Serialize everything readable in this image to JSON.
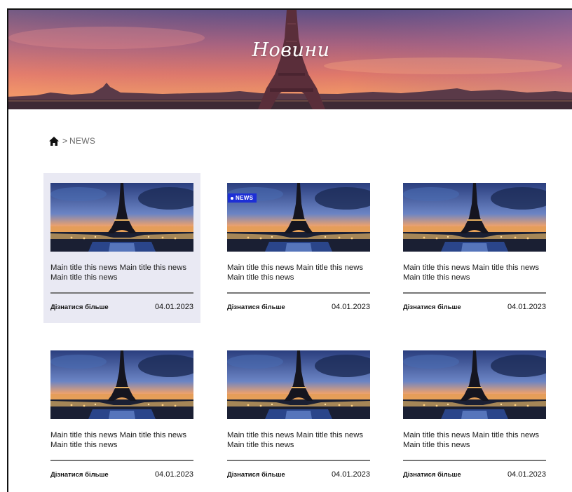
{
  "hero": {
    "title": "Новини"
  },
  "breadcrumb": {
    "home_icon": "home-icon",
    "separator": ">",
    "current": "NEWS"
  },
  "cards": [
    {
      "title": "Main title this news Main title this news Main title this news",
      "more": "Дізнатися більше",
      "date": "04.01.2023",
      "badge": "",
      "active": true
    },
    {
      "title": "Main title this news Main title this news Main title this news",
      "more": "Дізнатися більше",
      "date": "04.01.2023",
      "badge": "NEWS",
      "active": false
    },
    {
      "title": "Main title this news Main title this news Main title this news",
      "more": "Дізнатися більше",
      "date": "04.01.2023",
      "badge": "",
      "active": false
    },
    {
      "title": "Main title this news Main title this news Main title this news",
      "more": "Дізнатися більше",
      "date": "04.01.2023",
      "badge": "",
      "active": false
    },
    {
      "title": "Main title this news Main title this news Main title this news",
      "more": "Дізнатися більше",
      "date": "04.01.2023",
      "badge": "",
      "active": false
    },
    {
      "title": "Main title this news Main title this news Main title this news",
      "more": "Дізнатися більше",
      "date": "04.01.2023",
      "badge": "",
      "active": false
    }
  ],
  "colors": {
    "badge": "#1d2fd6",
    "active_card": "#e9e9f3",
    "divider": "#777777"
  }
}
